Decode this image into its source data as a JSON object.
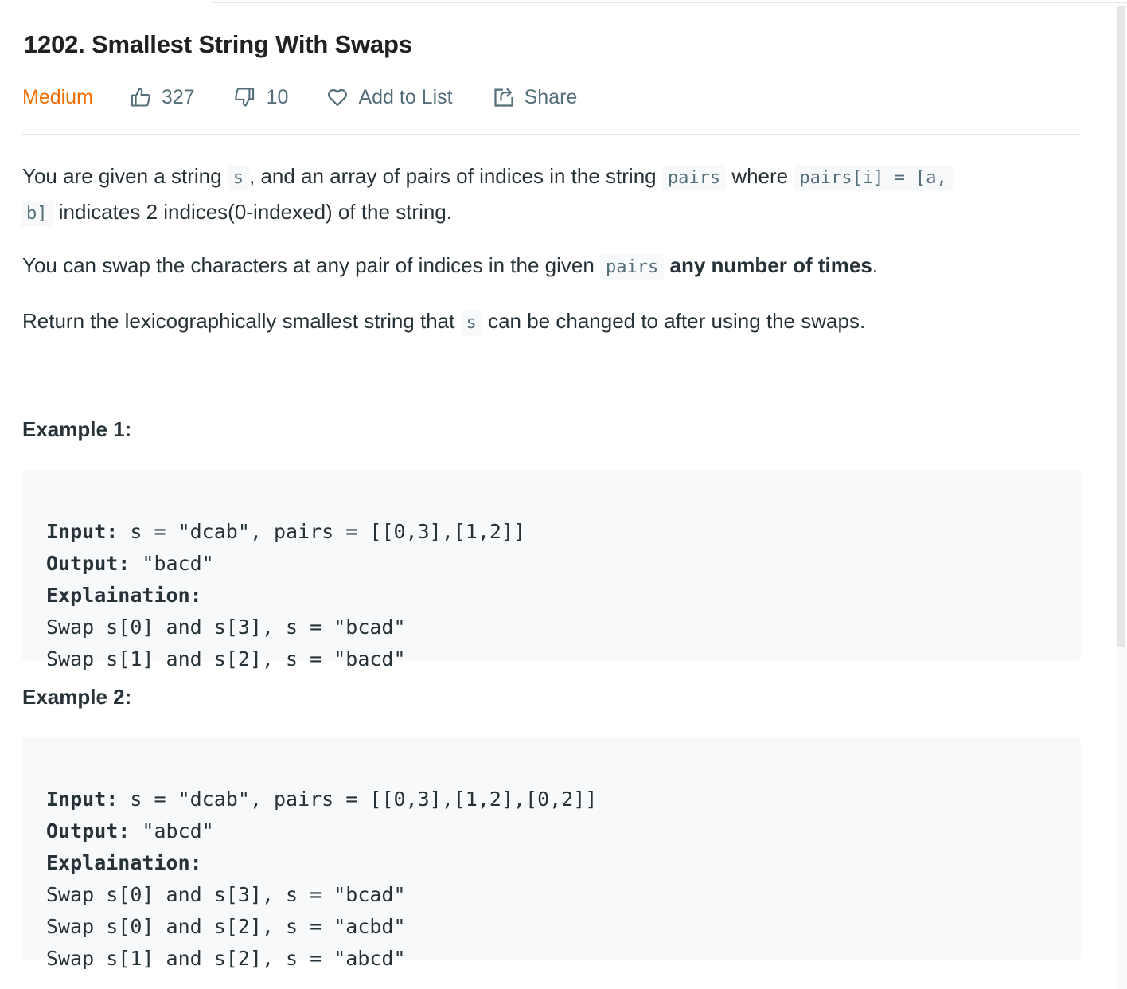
{
  "problem": {
    "title": "1202. Smallest String With Swaps",
    "difficulty": "Medium",
    "likes": "327",
    "dislikes": "10",
    "add_to_list_label": "Add to List",
    "share_label": "Share"
  },
  "description": {
    "p1": {
      "t1": "You are given a string ",
      "c1": "s",
      "t2": ", and an array of pairs of indices in the string ",
      "c2": "pairs",
      "t3": " where ",
      "c3": "pairs[i] = [a,",
      "c4": "b]",
      "t4": " indicates 2 indices(0-indexed) of the string."
    },
    "p2": {
      "t1": "You can swap the characters at any pair of indices in the given ",
      "c1": "pairs",
      "bold": "any number of times",
      "t2": "."
    },
    "p3": {
      "t1": "Return the lexicographically smallest string that ",
      "c1": "s",
      "t2": " can be changed to after using the swaps."
    }
  },
  "examples": [
    {
      "title": "Example 1:",
      "input_label": "Input:",
      "input_value": " s = \"dcab\", pairs = [[0,3],[1,2]]",
      "output_label": "Output:",
      "output_value": " \"bacd\"",
      "explanation_label": "Explaination:",
      "steps": [
        "Swap s[0] and s[3], s = \"bcad\"",
        "Swap s[1] and s[2], s = \"bacd\""
      ]
    },
    {
      "title": "Example 2:",
      "input_label": "Input:",
      "input_value": " s = \"dcab\", pairs = [[0,3],[1,2],[0,2]]",
      "output_label": "Output:",
      "output_value": " \"abcd\"",
      "explanation_label": "Explaination:",
      "steps": [
        "Swap s[0] and s[3], s = \"bcad\"",
        "Swap s[0] and s[2], s = \"acbd\"",
        "Swap s[1] and s[2], s = \"abcd\""
      ]
    }
  ],
  "colors": {
    "difficulty_medium": "#ef6c00",
    "meta_text": "#546e7a",
    "code_bg": "#f7f9fa",
    "divider": "#e4e7ea"
  },
  "icons": {
    "like": "thumbs-up-icon",
    "dislike": "thumbs-down-icon",
    "add_to_list": "heart-icon",
    "share": "share-icon"
  }
}
